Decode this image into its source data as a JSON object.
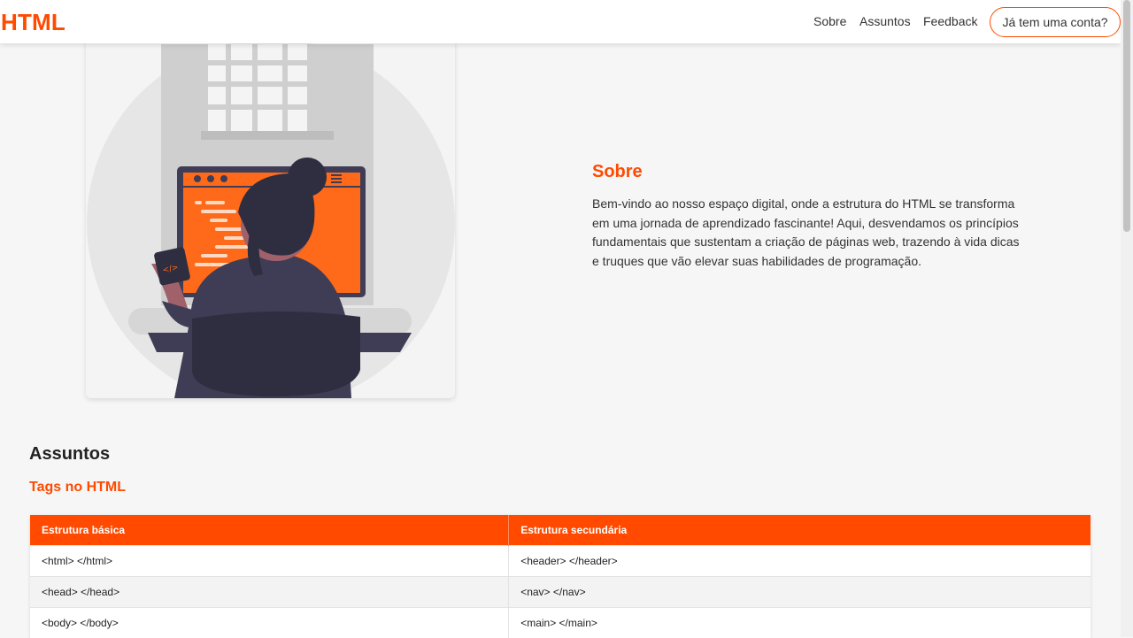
{
  "navbar": {
    "brand": "HTML",
    "links": [
      "Sobre",
      "Assuntos",
      "Feedback"
    ],
    "login_button": "Já tem uma conta?"
  },
  "about": {
    "title": "Sobre",
    "text": "Bem-vindo ao nosso espaço digital, onde a estrutura do HTML se transforma em uma jornada de aprendizado fascinante! Aqui, desvendamos os princípios fundamentais que sustentam a criação de páginas web, trazendo à vida dicas e truques que vão elevar suas habilidades de programação."
  },
  "topics": {
    "title": "Assuntos",
    "subtitle": "Tags no HTML",
    "table": {
      "headers": [
        "Estrutura básica",
        "Estrutura secundária"
      ],
      "rows": [
        [
          "<html> </html>",
          "<header> </header>"
        ],
        [
          "<head> </head>",
          "<nav> </nav>"
        ],
        [
          "<body> </body>",
          "<main> </main>"
        ]
      ]
    }
  },
  "illustration": {
    "mug_text": "</>"
  },
  "colors": {
    "accent": "#ff4a00",
    "screen": "#ff6a1a",
    "dark": "#2f2e41",
    "skin": "#a0616a"
  }
}
